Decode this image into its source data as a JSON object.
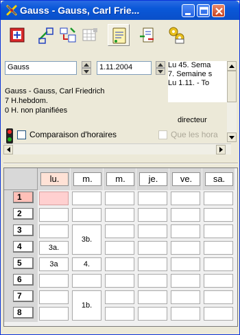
{
  "window": {
    "title": "Gauss - Gauss, Carl Frie...",
    "icon": "untis-cross-icon",
    "controls": [
      "minimize",
      "maximize",
      "close"
    ]
  },
  "toolbar": {
    "tools": [
      {
        "name": "move-icon",
        "pressed": false
      },
      {
        "name": "split-icon",
        "pressed": false
      },
      {
        "name": "transfer-icon",
        "pressed": false
      },
      {
        "name": "grid-disabled-icon",
        "pressed": false
      },
      {
        "name": "notes-icon",
        "pressed": true
      },
      {
        "name": "swap-icon",
        "pressed": false
      },
      {
        "name": "gears-icon",
        "pressed": false
      }
    ]
  },
  "info": {
    "teacher_field": "Gauss",
    "date_field": "1.11.2004",
    "teacher_full": "Gauss - Gauss, Carl Friedrich",
    "hours_week": "7  H.hebdom.",
    "hours_unplanned": "0  H. non planifiées",
    "compare_label": "Comparaison d'horaires",
    "compare_checked": false,
    "only_label": "Que les hora",
    "list_lines": [
      "Lu 45. Sema",
      "7. Semaine s",
      "Lu 1.11. - To"
    ],
    "role_label": "directeur"
  },
  "grid": {
    "days": [
      "lu.",
      "m.",
      "m.",
      "je.",
      "ve.",
      "sa."
    ],
    "periods": [
      "1",
      "2",
      "3",
      "4",
      "5",
      "6",
      "7",
      "8"
    ],
    "active_period": "1",
    "lessons": [
      {
        "day": 0,
        "start": 3,
        "end": 3,
        "text": "3a."
      },
      {
        "day": 0,
        "start": 4,
        "end": 4,
        "text": "3a"
      },
      {
        "day": 1,
        "start": 2,
        "end": 3,
        "text": "3b."
      },
      {
        "day": 1,
        "start": 4,
        "end": 4,
        "text": "4."
      },
      {
        "day": 1,
        "start": 6,
        "end": 7,
        "text": "1b."
      }
    ]
  },
  "colors": {
    "title_bar": "#0a58d8",
    "window_bg": "#ece9d8",
    "selected_cell": "#ffd0d0",
    "active_period": "#ffc0b8"
  }
}
